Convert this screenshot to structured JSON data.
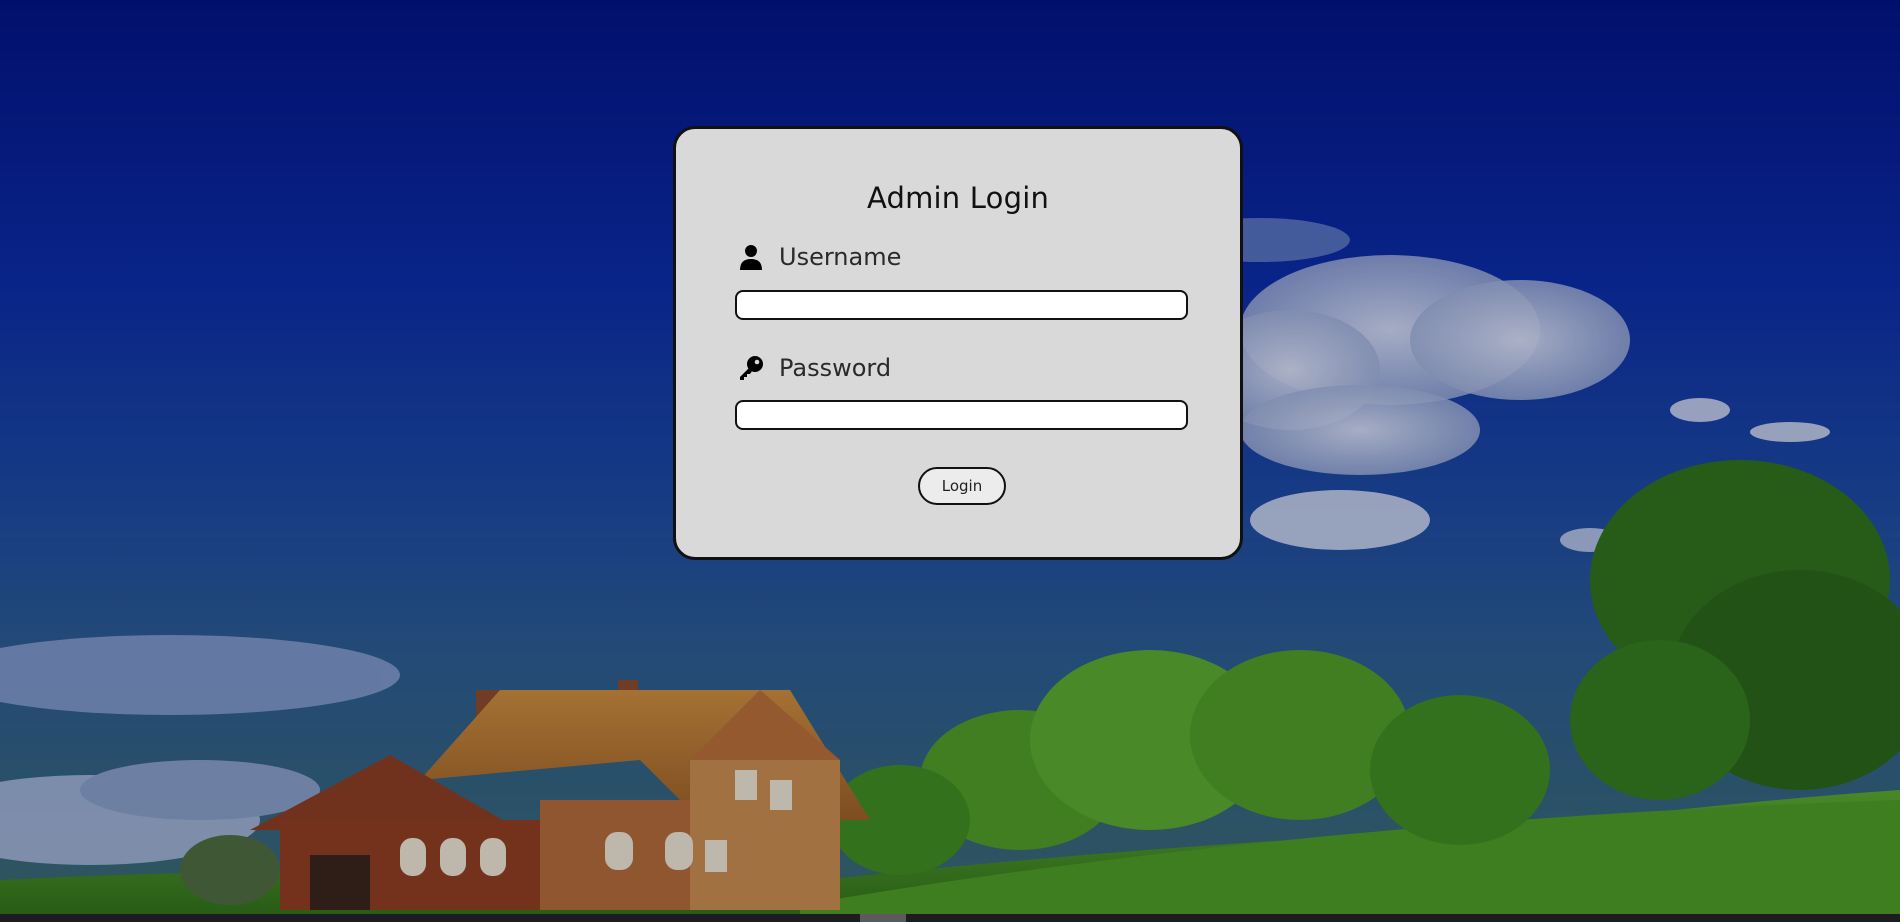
{
  "login_form": {
    "title": "Admin Login",
    "username": {
      "label": "Username",
      "icon": "user-icon",
      "value": "",
      "placeholder": ""
    },
    "password": {
      "label": "Password",
      "icon": "key-icon",
      "value": "",
      "placeholder": ""
    },
    "submit_label": "Login"
  },
  "colors": {
    "card_background": "#d9d9d9",
    "card_border": "#111111",
    "sky_top": "#02137e",
    "grass": "#4a9a1e"
  }
}
